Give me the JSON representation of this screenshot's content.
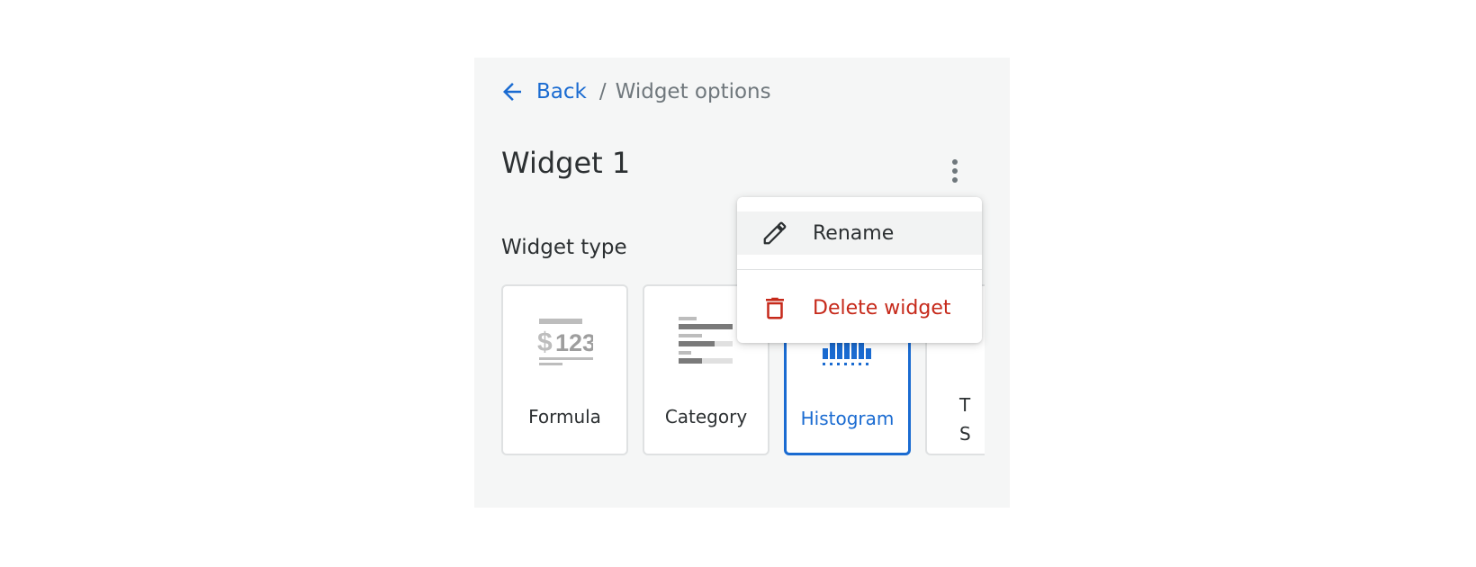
{
  "breadcrumb": {
    "back_label": "Back",
    "separator": "/",
    "current": "Widget options"
  },
  "title": "Widget 1",
  "widget_type": {
    "label": "Widget type",
    "options": [
      {
        "label": "Formula",
        "icon": "formula-icon",
        "selected": false
      },
      {
        "label": "Category",
        "icon": "category-icon",
        "selected": false
      },
      {
        "label": "Histogram",
        "icon": "histogram-icon",
        "selected": true
      },
      {
        "label": "T\nS",
        "icon": "time-series-icon",
        "selected": false
      }
    ]
  },
  "menu": {
    "rename_label": "Rename",
    "delete_label": "Delete widget"
  },
  "colors": {
    "accent": "#1a6bd1",
    "danger": "#c6291a",
    "text": "#2c3032",
    "muted": "#6f777c",
    "panel_bg": "#f5f6f6"
  }
}
